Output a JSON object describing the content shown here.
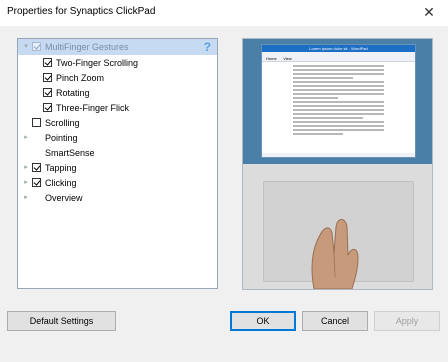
{
  "window": {
    "title": "Properties for Synaptics ClickPad",
    "close_glyph": "✕"
  },
  "tree": {
    "help_glyph": "?",
    "items": [
      {
        "label": "MultiFinger Gestures",
        "checked": true,
        "expander": "▾",
        "selected": true
      },
      {
        "label": "Two-Finger Scrolling",
        "checked": true
      },
      {
        "label": "Pinch Zoom",
        "checked": true
      },
      {
        "label": "Rotating",
        "checked": true
      },
      {
        "label": "Three-Finger Flick",
        "checked": true
      },
      {
        "label": "Scrolling",
        "checked": false
      },
      {
        "label": "Pointing",
        "expander": "▸"
      },
      {
        "label": "SmartSense"
      },
      {
        "label": "Tapping",
        "checked": true,
        "expander": "▸"
      },
      {
        "label": "Clicking",
        "checked": true,
        "expander": "▸"
      },
      {
        "label": "Overview",
        "expander": "▸"
      }
    ]
  },
  "preview": {
    "window_title": "Lorem ipsum dolor sit - WordPad",
    "ribbon_tabs": [
      "Home",
      "View"
    ]
  },
  "buttons": {
    "default_settings": "Default Settings",
    "ok": "OK",
    "cancel": "Cancel",
    "apply": "Apply"
  },
  "colors": {
    "selection": "#c6dbf2",
    "accent": "#0078d7",
    "desktop": "#4a7fa8"
  }
}
